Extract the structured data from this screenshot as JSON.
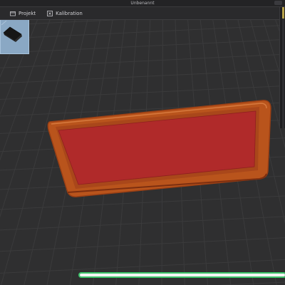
{
  "window": {
    "title": "Unbenannt"
  },
  "tabs": [
    {
      "label": "Projekt",
      "icon": "folder-icon"
    },
    {
      "label": "Kalibration",
      "icon": "calibration-icon"
    }
  ],
  "colors": {
    "grid_background": "#2f2f30",
    "grid_line": "#3b3b3c",
    "model_rim": "#b9541c",
    "model_surface": "#b02a2a",
    "progress_border": "#3cc46a",
    "progress_fill": "#f4f4f4"
  },
  "object_thumbnail": {
    "icon": "part-preview-icon",
    "selected": true
  },
  "progress": {
    "fraction": 1.0
  }
}
